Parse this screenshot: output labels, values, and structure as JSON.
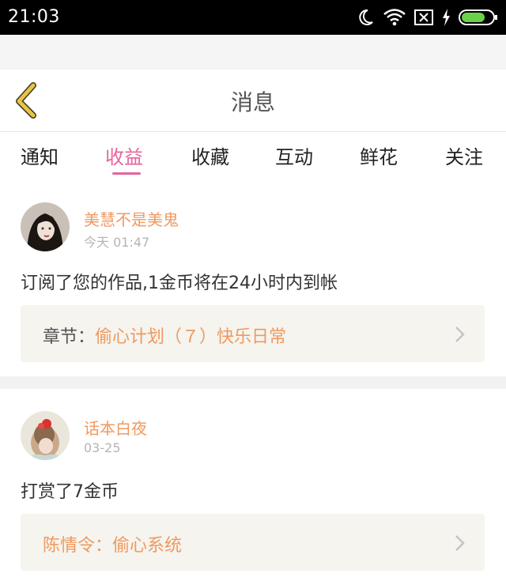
{
  "status_bar": {
    "time": "21:03",
    "icons": [
      "moon-icon",
      "wifi-icon",
      "no-sim-icon",
      "charging-icon",
      "battery-icon"
    ]
  },
  "header": {
    "title": "消息",
    "back_icon": "chevron-left-icon"
  },
  "tabs": [
    {
      "label": "通知",
      "active": false
    },
    {
      "label": "收益",
      "active": true
    },
    {
      "label": "收藏",
      "active": false
    },
    {
      "label": "互动",
      "active": false
    },
    {
      "label": "鲜花",
      "active": false
    },
    {
      "label": "关注",
      "active": false
    }
  ],
  "messages": [
    {
      "username": "美慧不是美鬼",
      "time": "今天 01:47",
      "text": "订阅了您的作品,1金币将在24小时内到帐",
      "work_prefix": "章节：",
      "work_title": "偷心计划（７）快乐日常"
    },
    {
      "username": "话本白夜",
      "time": "03-25",
      "text": "打赏了7金币",
      "work_prefix": "",
      "work_title": "陈情令：偷心系统"
    }
  ],
  "colors": {
    "accent_pink": "#e5649c",
    "accent_orange": "#f0995f",
    "back_arrow": "#e8c24a"
  }
}
